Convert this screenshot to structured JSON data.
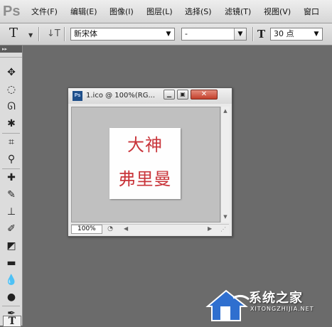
{
  "app": {
    "logo": "Ps"
  },
  "menu": {
    "items": [
      "文件(F)",
      "编辑(E)",
      "图像(I)",
      "图层(L)",
      "选择(S)",
      "滤镜(T)",
      "视图(V)",
      "窗口"
    ]
  },
  "options": {
    "tool_glyph": "T",
    "orientation_glyph": "↓T",
    "font_family": "新宋体",
    "font_style": "-",
    "size_glyph": "T",
    "font_size": "30 点"
  },
  "toolbox": {
    "header": "▸▸",
    "tools": [
      "move-tool",
      "marquee-tool",
      "lasso-tool",
      "magic-wand-tool",
      "crop-tool",
      "eyedropper-tool",
      "healing-brush-tool",
      "brush-tool",
      "clone-stamp-tool",
      "history-brush-tool",
      "eraser-tool",
      "gradient-tool",
      "blur-tool",
      "dodge-tool",
      "pen-tool",
      "type-tool"
    ]
  },
  "document": {
    "badge": "Ps",
    "title": "1.ico @ 100%(RG...",
    "close_glyph": "✕",
    "canvas_text": {
      "line1": "大神",
      "line2": "弗里曼"
    },
    "zoom": "100%"
  },
  "watermark": {
    "title": "系统之家",
    "url": "XITONGZHIJIA.NET"
  },
  "colors": {
    "workspace": "#6b6b6b",
    "text_red": "#c9353b",
    "close_red": "#c3402c"
  }
}
